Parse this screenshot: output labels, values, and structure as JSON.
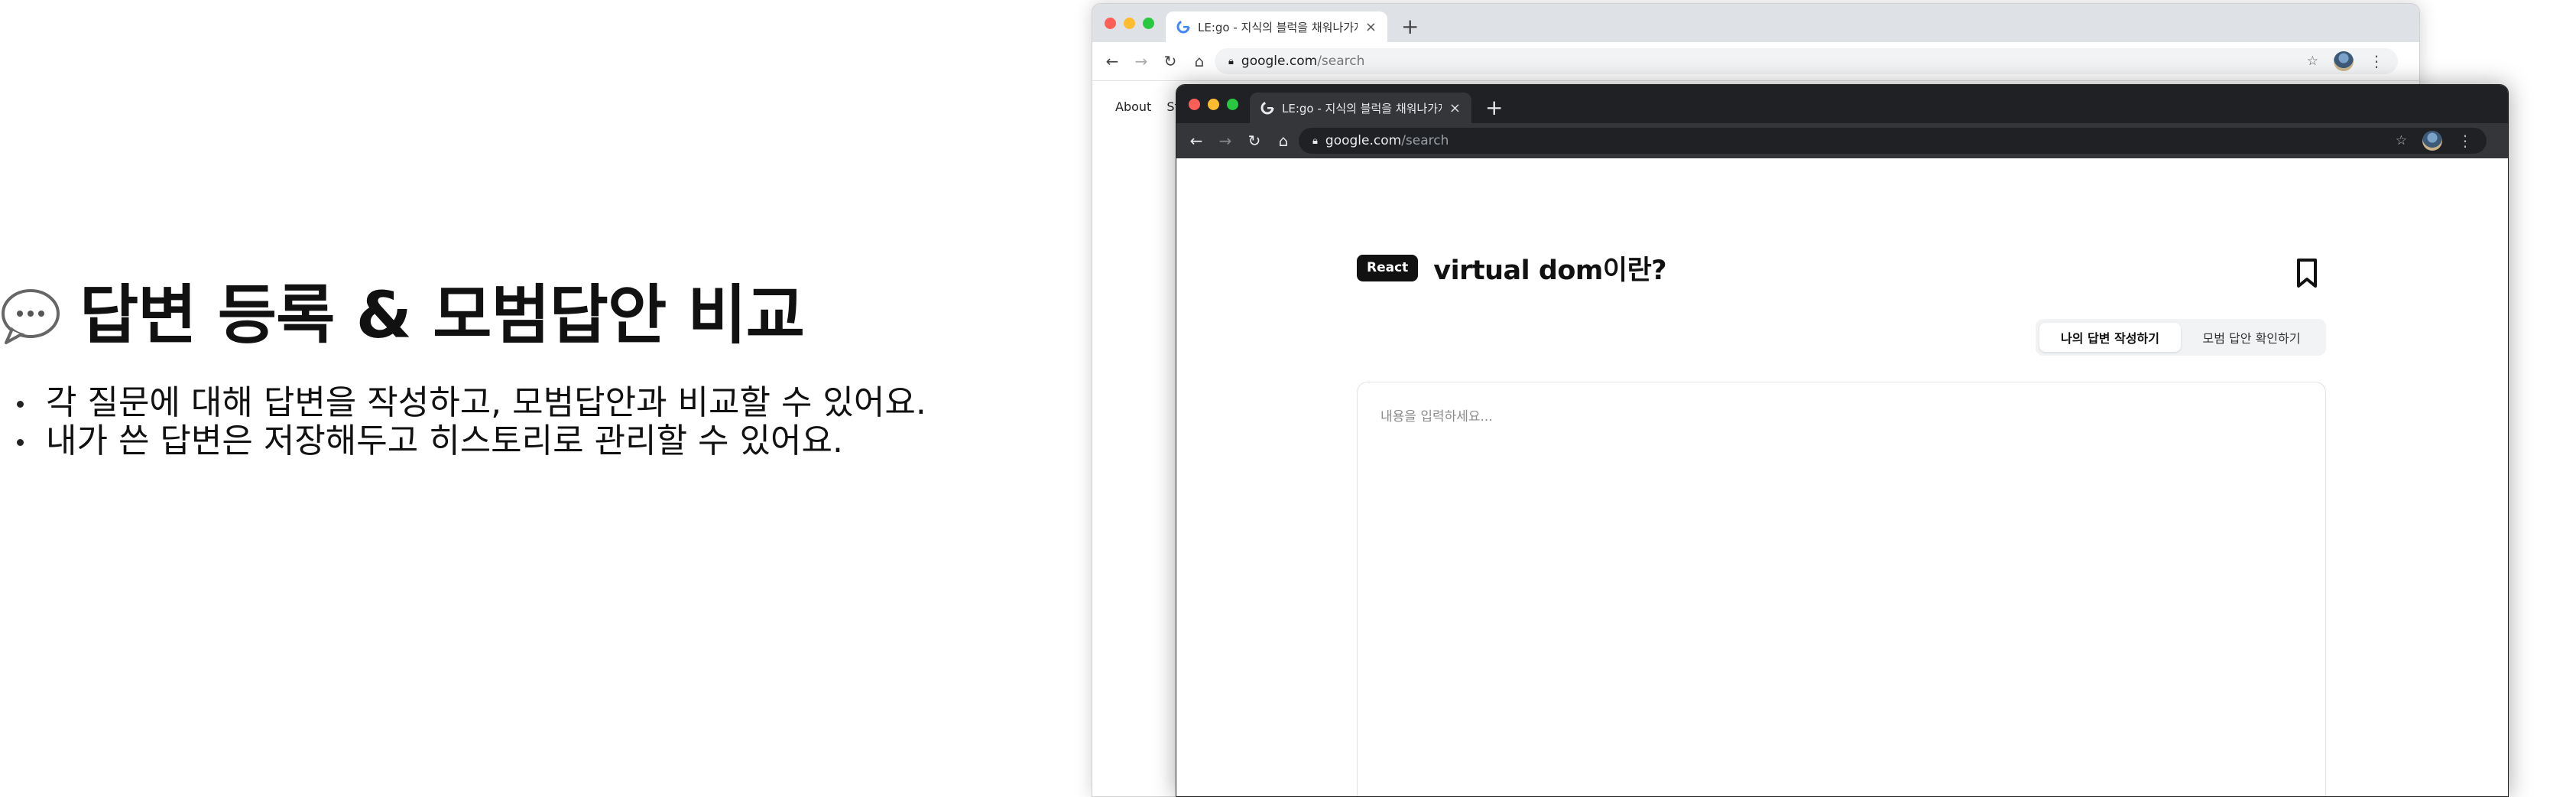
{
  "feature": {
    "title": "답변 등록 & 모범답안 비교",
    "icon": "speech-bubble-icon",
    "bullets": [
      "각 질문에 대해 답변을 작성하고, 모범답안과 비교할 수 있어요.",
      "내가 쓴 답변은 저장해두고 히스토리로 관리할 수 있어요."
    ]
  },
  "back_browser": {
    "tab_title": "LE:go - 지식의 블럭을 채워나가자!",
    "url_host": "google.com",
    "url_path": "/search",
    "nav_links": [
      "About",
      "Sto"
    ]
  },
  "front_browser": {
    "tab_title": "LE:go - 지식의 블럭을 채워나가자!",
    "url_host": "google.com",
    "url_path": "/search"
  },
  "question": {
    "category": "React",
    "title": "virtual dom이란?"
  },
  "tabs": {
    "my_answer": "나의 답변 작성하기",
    "model_answer": "모범 답안 확인하기",
    "active": "my_answer"
  },
  "answer": {
    "placeholder": "내용을 입력하세요...",
    "value": ""
  },
  "colors": {
    "window_red": "#ff5f57",
    "window_yellow": "#febc2e",
    "window_green": "#28c840",
    "dark_chrome": "#202124",
    "badge_bg": "#111111"
  }
}
